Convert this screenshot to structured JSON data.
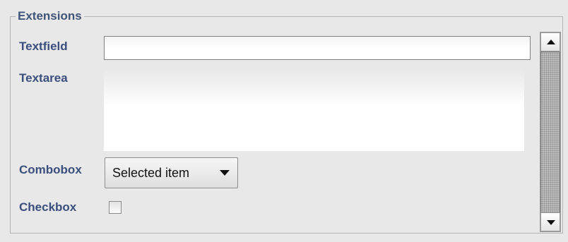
{
  "panel": {
    "legend": "Extensions",
    "colors": {
      "label": "#3a4f7d",
      "background": "#e8e8e8"
    }
  },
  "fields": {
    "textfield": {
      "label": "Textfield",
      "value": ""
    },
    "textarea": {
      "label": "Textarea",
      "value": ""
    },
    "combobox": {
      "label": "Combobox",
      "selected": "Selected item"
    },
    "checkbox": {
      "label": "Checkbox",
      "checked": false
    }
  },
  "scrollbar": {
    "icons": [
      "arrow-up-icon",
      "arrow-down-icon"
    ]
  }
}
